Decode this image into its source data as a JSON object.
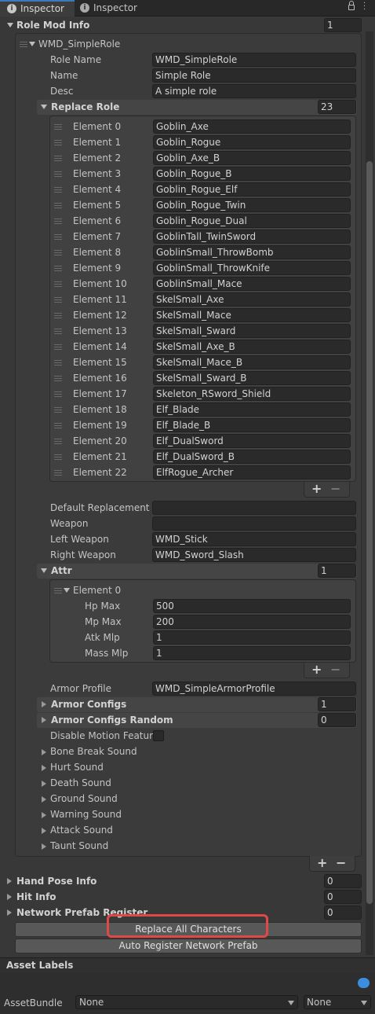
{
  "tabs": [
    {
      "label": "Inspector"
    },
    {
      "label": "Inspector"
    }
  ],
  "role_mod_info": {
    "label": "Role Mod Info",
    "count": "1"
  },
  "role": {
    "header": "WMD_SimpleRole",
    "role_name_label": "Role Name",
    "role_name": "WMD_SimpleRole",
    "name_label": "Name",
    "name": "Simple Role",
    "desc_label": "Desc",
    "desc": "A simple role",
    "replace_role": {
      "label": "Replace Role",
      "count": "23",
      "elements": [
        {
          "label": "Element 0",
          "value": "Goblin_Axe"
        },
        {
          "label": "Element 1",
          "value": "Goblin_Rogue"
        },
        {
          "label": "Element 2",
          "value": "Goblin_Axe_B"
        },
        {
          "label": "Element 3",
          "value": "Goblin_Rogue_B"
        },
        {
          "label": "Element 4",
          "value": "Goblin_Rogue_Elf"
        },
        {
          "label": "Element 5",
          "value": "Goblin_Rogue_Twin"
        },
        {
          "label": "Element 6",
          "value": "Goblin_Rogue_Dual"
        },
        {
          "label": "Element 7",
          "value": "GoblinTall_TwinSword"
        },
        {
          "label": "Element 8",
          "value": "GoblinSmall_ThrowBomb"
        },
        {
          "label": "Element 9",
          "value": "GoblinSmall_ThrowKnife"
        },
        {
          "label": "Element 10",
          "value": "GoblinSmall_Mace"
        },
        {
          "label": "Element 11",
          "value": "SkelSmall_Axe"
        },
        {
          "label": "Element 12",
          "value": "SkelSmall_Mace"
        },
        {
          "label": "Element 13",
          "value": "SkelSmall_Sward"
        },
        {
          "label": "Element 14",
          "value": "SkelSmall_Axe_B"
        },
        {
          "label": "Element 15",
          "value": "SkelSmall_Mace_B"
        },
        {
          "label": "Element 16",
          "value": "SkelSmall_Sward_B"
        },
        {
          "label": "Element 17",
          "value": "Skeleton_RSword_Shield"
        },
        {
          "label": "Element 18",
          "value": "Elf_Blade"
        },
        {
          "label": "Element 19",
          "value": "Elf_Blade_B"
        },
        {
          "label": "Element 20",
          "value": "Elf_DualSword"
        },
        {
          "label": "Element 21",
          "value": "Elf_DualSword_B"
        },
        {
          "label": "Element 22",
          "value": "ElfRogue_Archer"
        }
      ]
    },
    "default_replacement_label": "Default Replacement",
    "default_replacement": "",
    "weapon_label": "Weapon",
    "weapon": "",
    "left_weapon_label": "Left Weapon",
    "left_weapon": "WMD_Stick",
    "right_weapon_label": "Right Weapon",
    "right_weapon": "WMD_Sword_Slash",
    "attr": {
      "label": "Attr",
      "count": "1",
      "element_label": "Element 0",
      "hp_max_label": "Hp Max",
      "hp_max": "500",
      "mp_max_label": "Mp Max",
      "mp_max": "200",
      "atk_mlp_label": "Atk Mlp",
      "atk_mlp": "1",
      "mass_mlp_label": "Mass Mlp",
      "mass_mlp": "1"
    },
    "armor_profile_label": "Armor Profile",
    "armor_profile": "WMD_SimpleArmorProfile",
    "armor_configs_label": "Armor Configs",
    "armor_configs": "1",
    "armor_configs_random_label": "Armor Configs Random",
    "armor_configs_random": "0",
    "disable_motion_label": "Disable Motion Feature",
    "sounds": [
      "Bone Break Sound",
      "Hurt Sound",
      "Death Sound",
      "Ground Sound",
      "Warning Sound",
      "Attack Sound",
      "Taunt Sound"
    ]
  },
  "hand_pose_info": {
    "label": "Hand Pose Info",
    "count": "0"
  },
  "hit_info": {
    "label": "Hit Info",
    "count": "0"
  },
  "network_prefab_register": {
    "label": "Network Prefab Register",
    "count": "0"
  },
  "buttons": {
    "replace_all": "Replace All Characters",
    "auto_register": "Auto Register Network Prefab"
  },
  "asset_labels": "Asset Labels",
  "asset_bundle": {
    "label": "AssetBundle",
    "value": "None",
    "variant": "None"
  },
  "colors": {
    "highlight_box": "#e04848",
    "panel_bg": "#3e3e3e",
    "field_bg": "#2a2a2a"
  }
}
